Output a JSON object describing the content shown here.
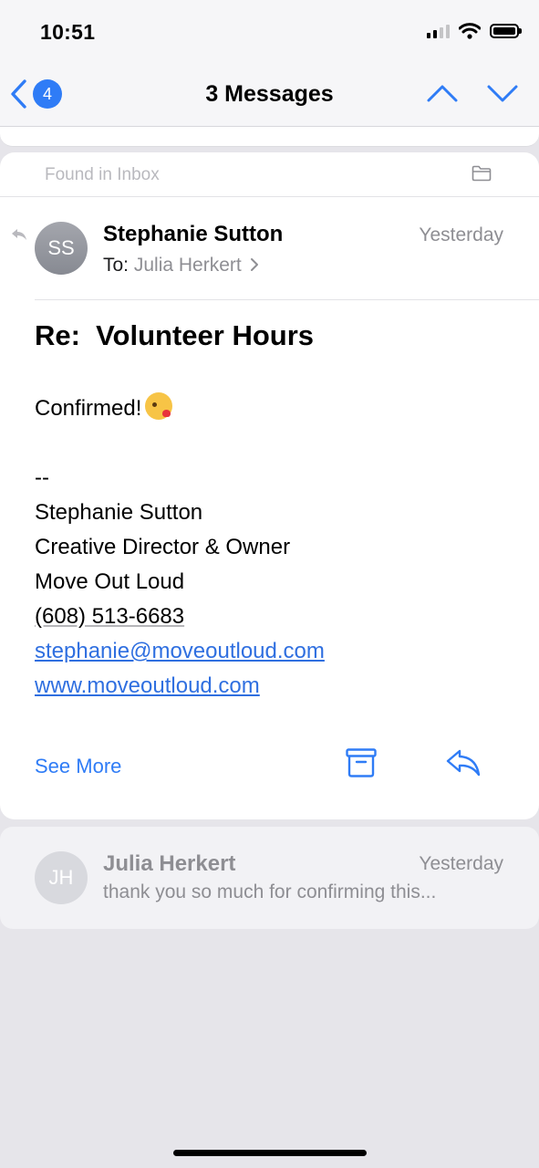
{
  "status_bar": {
    "time": "10:51",
    "icons": [
      "cellular-signal-icon",
      "wifi-icon",
      "battery-icon"
    ]
  },
  "nav": {
    "back_badge": "4",
    "title": "3 Messages",
    "icons": [
      "chevron-left-icon",
      "chevron-up-icon",
      "chevron-down-icon"
    ]
  },
  "colors": {
    "accent": "#2f7cf6",
    "link": "#2f6fe0",
    "secondary_text": "#8e8e93",
    "background": "#e6e5ea"
  },
  "message": {
    "found_in": "Found in Inbox",
    "avatar_initials": "SS",
    "sender": "Stephanie Sutton",
    "date": "Yesterday",
    "to_label": "To:",
    "recipient": "Julia Herkert",
    "subject": "Re:  Volunteer Hours",
    "body_first": "Confirmed!",
    "emoji": "kissing-face-emoji",
    "signature": {
      "dashes": "--",
      "name": "Stephanie Sutton",
      "title": "Creative Director & Owner",
      "company": "Move Out Loud",
      "phone": "(608) 513-6683",
      "email": "stephanie@moveoutloud.com",
      "website": "www.moveoutloud.com"
    },
    "see_more": "See More",
    "icons": [
      "folder-icon",
      "reply-indicator-icon",
      "archive-icon",
      "reply-icon"
    ]
  },
  "collapsed_message": {
    "avatar_initials": "JH",
    "sender": "Julia Herkert",
    "date": "Yesterday",
    "preview": "thank you so much for confirming this..."
  }
}
